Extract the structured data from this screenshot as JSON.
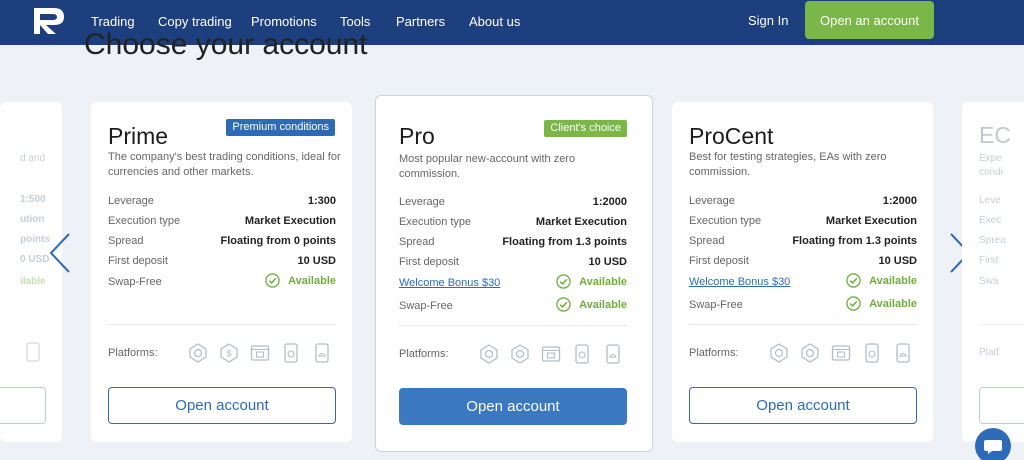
{
  "header": {
    "nav": [
      "Trading",
      "Copy trading",
      "Promotions",
      "Tools",
      "Partners",
      "About us"
    ],
    "sign_in": "Sign In",
    "open_account": "Open an account"
  },
  "page": {
    "heading": "Choose your account"
  },
  "row_labels": {
    "leverage": "Leverage",
    "execution": "Execution type",
    "spread": "Spread",
    "deposit": "First deposit",
    "swap": "Swap-Free",
    "bonus": "Welcome Bonus $30",
    "available": "Available",
    "platforms": "Platforms:",
    "open": "Open account"
  },
  "cards": [
    {
      "title": "Prime",
      "badge": "Premium conditions",
      "description": "The company's best trading conditions, ideal for currencies and other markets.",
      "leverage": "1:300",
      "execution": "Market Execution",
      "spread": "Floating from 0 points",
      "deposit": "10 USD"
    },
    {
      "title": "Pro",
      "badge": "Client's choice",
      "description": "Most popular new-account with zero commission.",
      "leverage": "1:2000",
      "execution": "Market Execution",
      "spread": "Floating from 1.3 points",
      "deposit": "10 USD"
    },
    {
      "title": "ProCent",
      "description": "Best for testing strategies, EAs with zero commission.",
      "leverage": "1:2000",
      "execution": "Market Execution",
      "spread": "Floating from 1.3 points",
      "deposit": "10 USD"
    }
  ],
  "left_partial": {
    "desc": "d and",
    "values": [
      "1:500",
      "ution",
      "points",
      "0 USD",
      "ilable"
    ]
  },
  "right_partial": {
    "title": "EC",
    "desc": [
      "Expe",
      "condi"
    ],
    "labels": [
      "Leve",
      "Exec",
      "Sprea",
      "First",
      "Swa"
    ],
    "platforms": "Platf"
  },
  "colors": {
    "header": "#1e3f7e",
    "accent_green": "#7ab648",
    "brand_blue": "#2d6bb8"
  }
}
